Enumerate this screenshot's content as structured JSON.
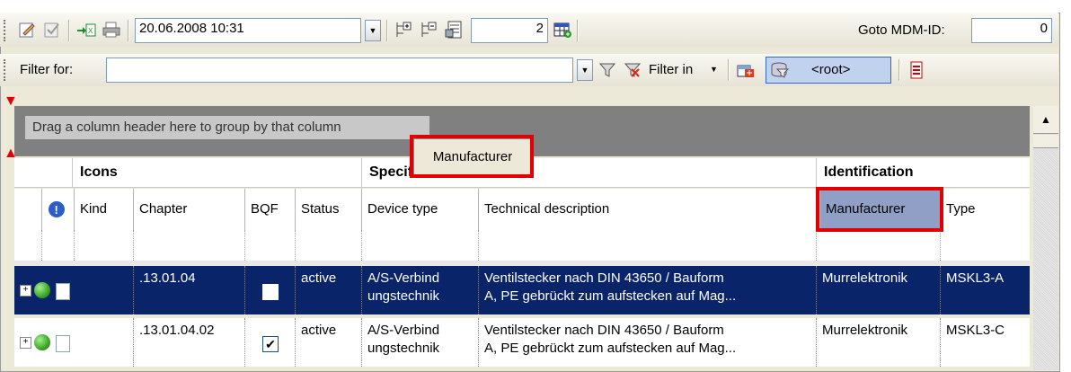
{
  "toolbar": {
    "datetime": "20.06.2008 10:31",
    "count_value": "2",
    "goto_label": "Goto MDM-ID:",
    "goto_value": "0",
    "icons": [
      "edit-icon",
      "approve-icon",
      "export-excel-icon",
      "print-icon",
      "expand-all-icon",
      "collapse-all-icon",
      "document-grid-icon",
      "table-add-icon"
    ]
  },
  "filterbar": {
    "filter_label": "Filter for:",
    "filter_value": "",
    "filter_in_label": "Filter in",
    "root_label": "<root>"
  },
  "grid": {
    "group_hint": "Drag a column header here to group by that column",
    "drag_header": "Manufacturer",
    "bands": {
      "icons": "Icons",
      "specification": "Specification",
      "identification": "Identification"
    },
    "columns": [
      "Kind",
      "Chapter",
      "BQF",
      "Status",
      "Device type",
      "Technical description",
      "Manufacturer",
      "Type"
    ],
    "rows": [
      {
        "chapter": ".13.01.04",
        "bqf": false,
        "status": "active",
        "device_type_1": "A/S-Verbind",
        "device_type_2": "ungstechnik",
        "description_1": "Ventilstecker nach DIN 43650 / Bauform",
        "description_2": "A, PE gebrückt zum aufstecken auf Mag...",
        "manufacturer": "Murrelektronik",
        "type": "MSKL3-A",
        "selected": true
      },
      {
        "chapter": ".13.01.04.02",
        "bqf": true,
        "check_glyph": "✔",
        "status": "active",
        "device_type_1": "A/S-Verbind",
        "device_type_2": "ungstechnik",
        "description_1": "Ventilstecker nach DIN 43650 / Bauform",
        "description_2": "A, PE gebrückt zum aufstecken auf Mag...",
        "manufacturer": "Murrelektronik",
        "type": "MSKL3-C",
        "selected": false
      }
    ]
  },
  "colors": {
    "selection": "#0a246a",
    "highlight": "#e30000"
  }
}
